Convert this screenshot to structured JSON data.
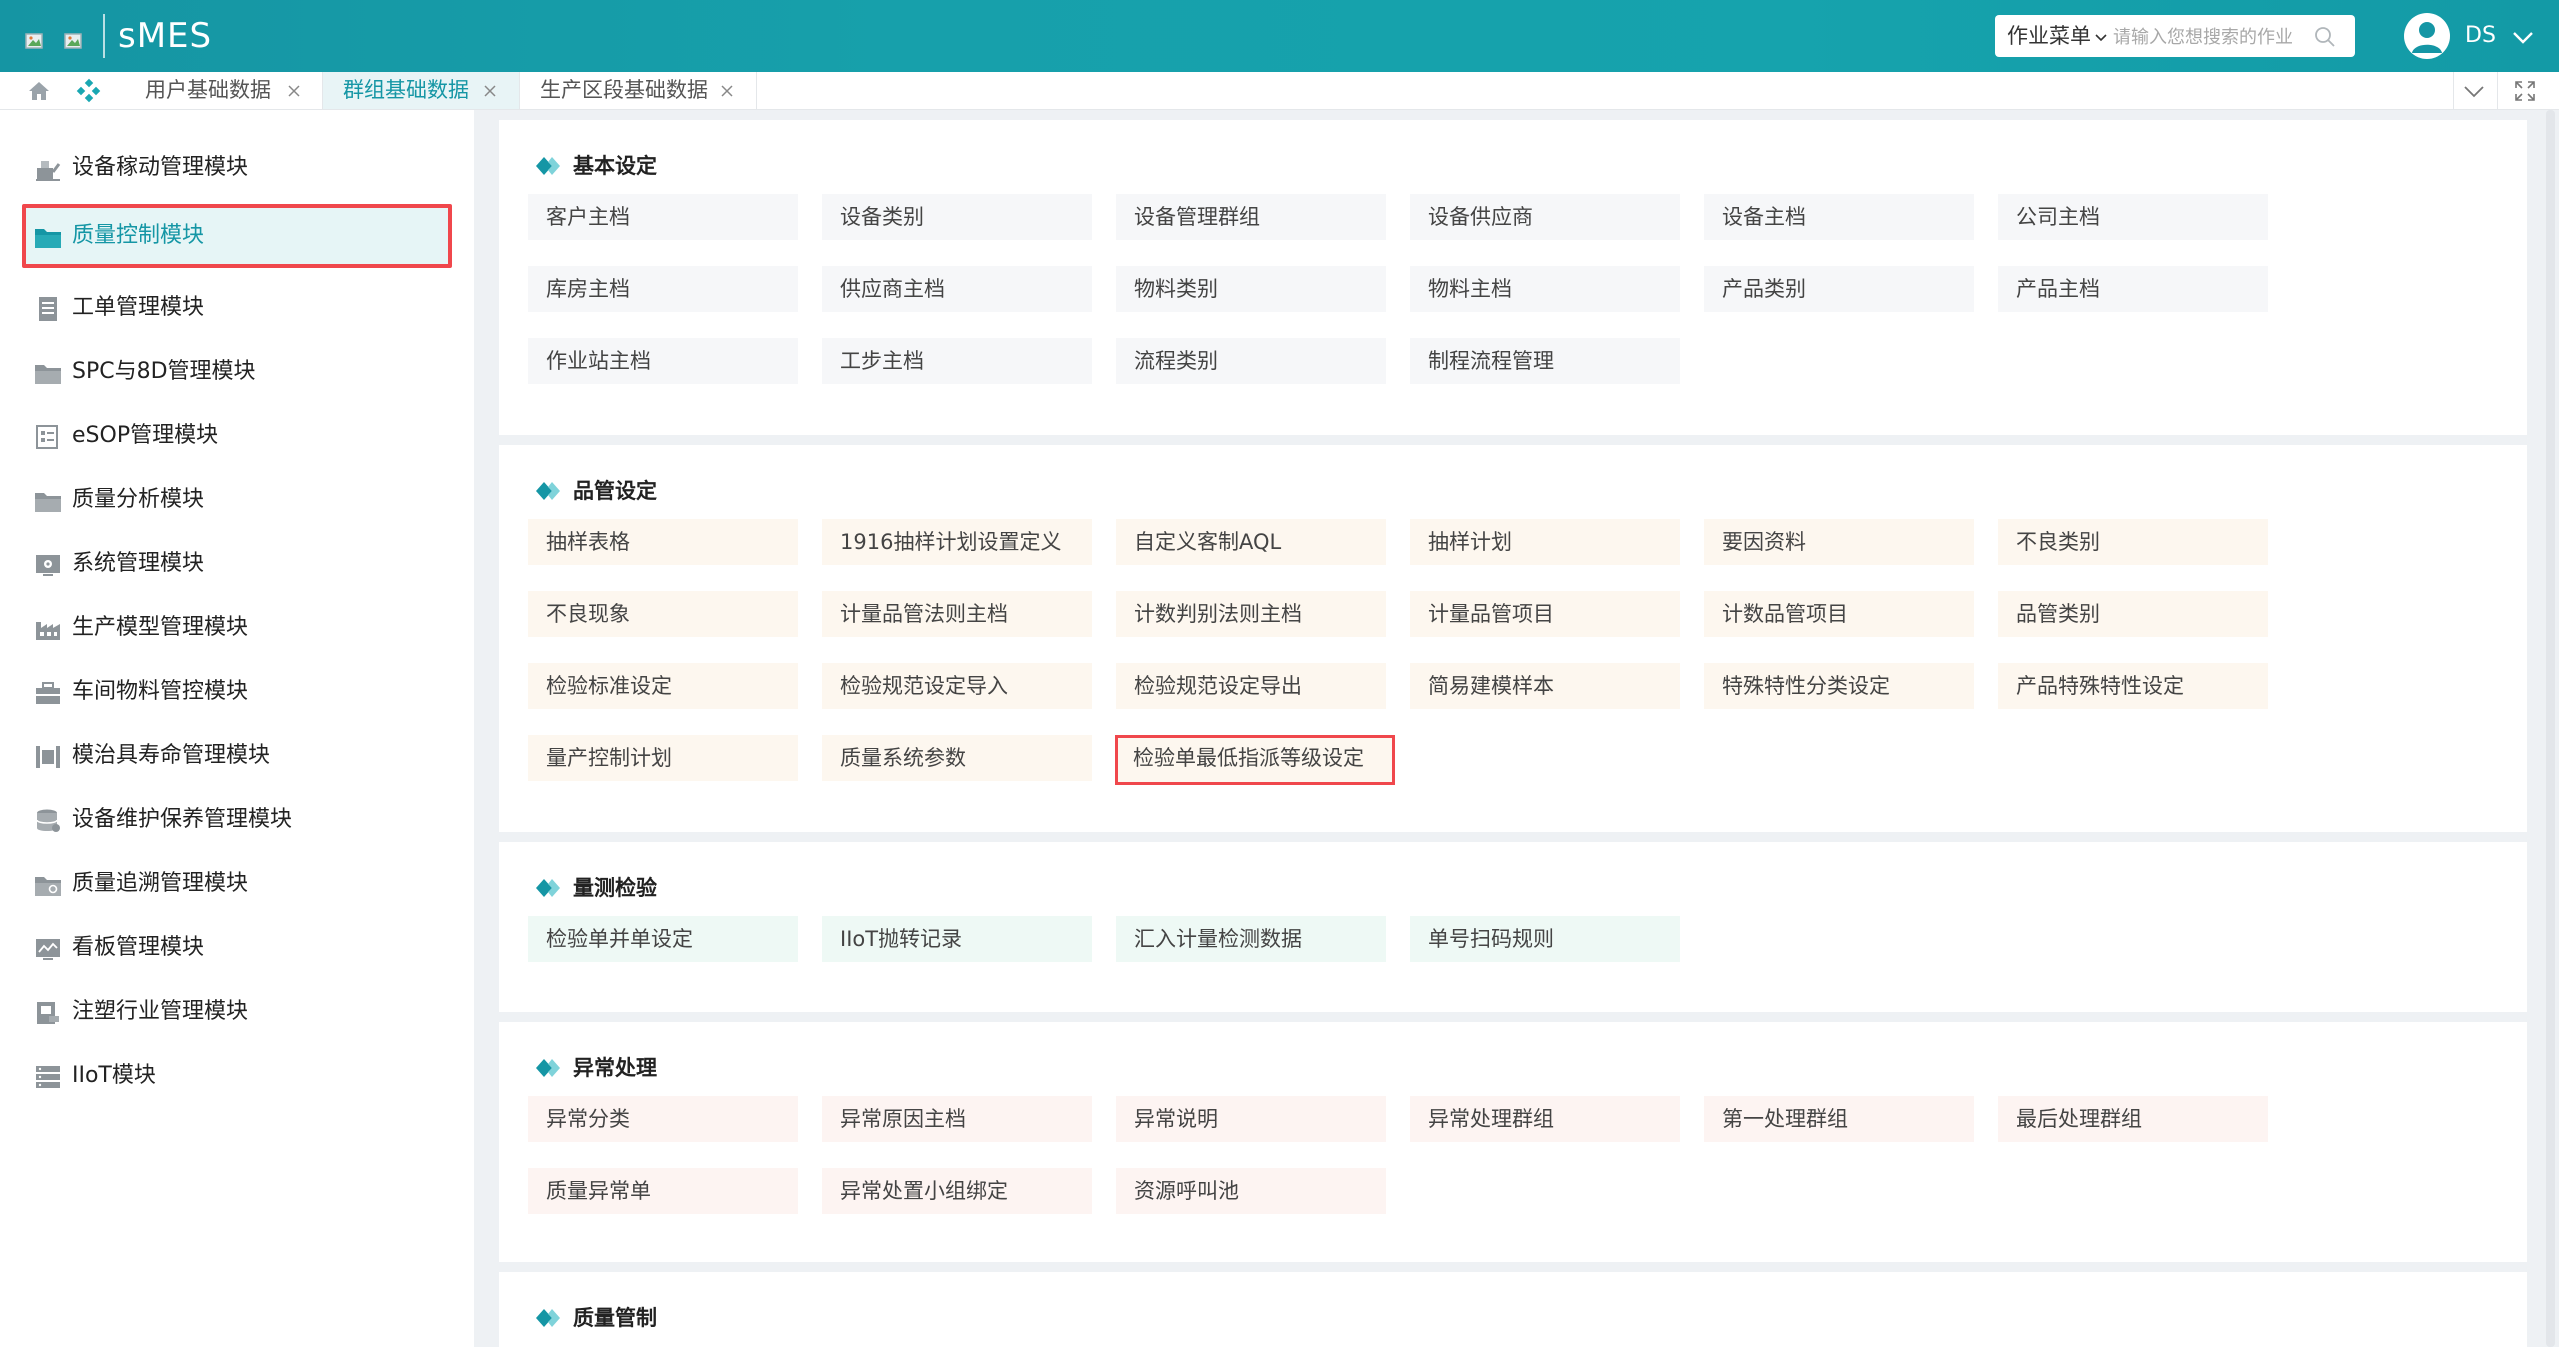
{
  "app": {
    "title": "sMES"
  },
  "header": {
    "menu_select": "作业菜单",
    "search_placeholder": "请输入您想搜索的作业",
    "user": "DS"
  },
  "tabs": [
    {
      "label": "用户基础数据",
      "active": false
    },
    {
      "label": "群组基础数据",
      "active": true
    },
    {
      "label": "生产区段基础数据",
      "active": false
    }
  ],
  "sidebar": {
    "items": [
      {
        "label": "设备稼动管理模块",
        "icon": "equipment-icon"
      },
      {
        "label": "质量控制模块",
        "icon": "folder-icon",
        "active": true
      },
      {
        "label": "工单管理模块",
        "icon": "document-icon"
      },
      {
        "label": "SPC与8D管理模块",
        "icon": "folder-icon"
      },
      {
        "label": "eSOP管理模块",
        "icon": "checklist-icon"
      },
      {
        "label": "质量分析模块",
        "icon": "folder-icon"
      },
      {
        "label": "系统管理模块",
        "icon": "settings-screen-icon"
      },
      {
        "label": "生产模型管理模块",
        "icon": "factory-icon"
      },
      {
        "label": "车间物料管控模块",
        "icon": "toolbox-icon"
      },
      {
        "label": "模治具寿命管理模块",
        "icon": "mold-icon"
      },
      {
        "label": "设备维护保养管理模块",
        "icon": "database-icon"
      },
      {
        "label": "质量追溯管理模块",
        "icon": "folder-search-icon"
      },
      {
        "label": "看板管理模块",
        "icon": "dashboard-icon"
      },
      {
        "label": "注塑行业管理模块",
        "icon": "injection-icon"
      },
      {
        "label": "IIoT模块",
        "icon": "server-icon"
      }
    ]
  },
  "sections": [
    {
      "title": "基本设定",
      "items": [
        "客户主档",
        "设备类别",
        "设备管理群组",
        "设备供应商",
        "设备主档",
        "公司主档",
        "库房主档",
        "供应商主档",
        "物料类别",
        "物料主档",
        "产品类别",
        "产品主档",
        "作业站主档",
        "工步主档",
        "流程类别",
        "制程流程管理"
      ]
    },
    {
      "title": "品管设定",
      "items": [
        "抽样表格",
        "1916抽样计划设置定义",
        "自定义客制AQL",
        "抽样计划",
        "要因资料",
        "不良类别",
        "不良现象",
        "计量品管法则主档",
        "计数判别法则主档",
        "计量品管项目",
        "计数品管项目",
        "品管类别",
        "检验标准设定",
        "检验规范设定导入",
        "检验规范设定导出",
        "简易建模样本",
        "特殊特性分类设定",
        "产品特殊特性设定",
        "量产控制计划",
        "质量系统参数",
        "检验单最低指派等级设定"
      ],
      "highlight_index": 20
    },
    {
      "title": "量测检验",
      "items": [
        "检验单并单设定",
        "IIoT抛转记录",
        "汇入计量检测数据",
        "单号扫码规则"
      ]
    },
    {
      "title": "异常处理",
      "items": [
        "异常分类",
        "异常原因主档",
        "异常说明",
        "异常处理群组",
        "第一处理群组",
        "最后处理群组",
        "质量异常单",
        "异常处置小组绑定",
        "资源呼叫池"
      ]
    },
    {
      "title": "质量管制",
      "items": []
    }
  ],
  "colors": {
    "accent": "#1596a5",
    "highlight": "#f0474c",
    "topbar": "#17a0ab"
  }
}
